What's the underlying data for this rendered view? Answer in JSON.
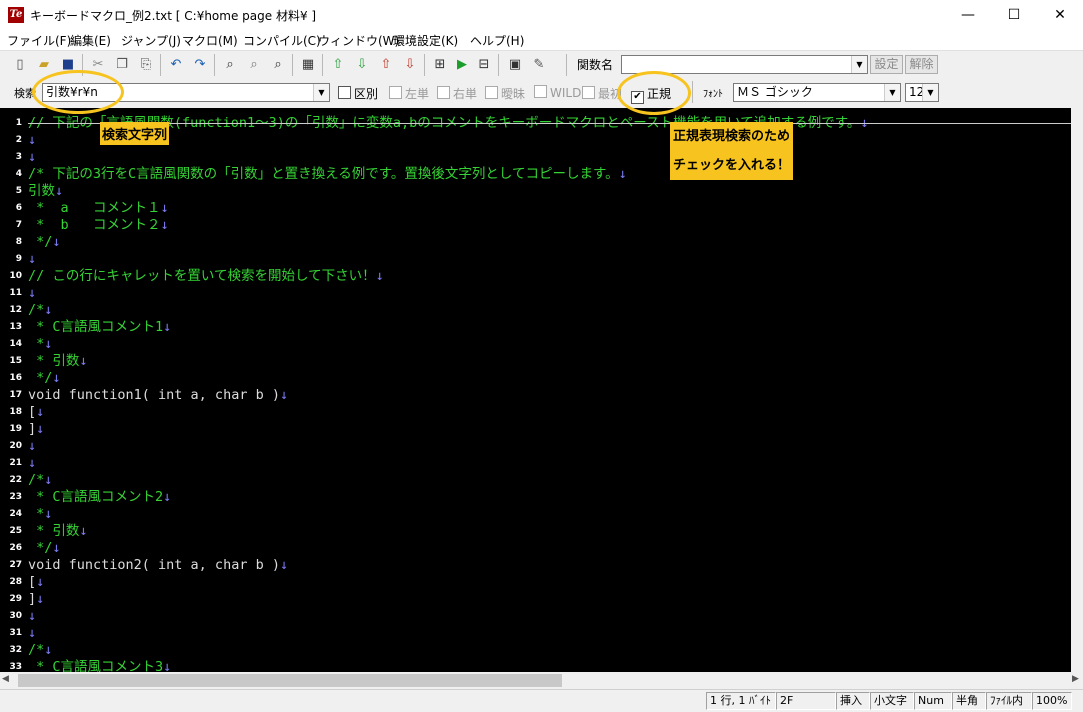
{
  "window": {
    "title": "キーボードマクロ_例2.txt [ C:¥home page 材料¥ ]",
    "app_icon": "Te",
    "controls": {
      "minimize": "—",
      "maximize": "☐",
      "close": "✕"
    }
  },
  "menu": [
    "ファイル(F)",
    "編集(E)",
    "ジャンプ(J)",
    "マクロ(M)",
    "コンパイル(C)",
    "ウィンドウ(W)",
    "環境設定(K)",
    "ヘルプ(H)"
  ],
  "toolbar": {
    "function_label": "関数名",
    "function_value": "",
    "set_button": "設定",
    "release_button": "解除",
    "icons": [
      "new-file-icon",
      "open-folder-icon",
      "save-icon",
      "cut-icon",
      "copy-icon",
      "paste-icon",
      "undo-icon",
      "redo-icon",
      "find-icon",
      "find-next-icon",
      "replace-icon",
      "grep-icon",
      "jump-up-icon",
      "jump-down-icon",
      "mark-up-icon",
      "mark-down-icon",
      "macro-record-icon",
      "macro-play-icon",
      "split-window-icon",
      "console-icon",
      "tool-icon"
    ]
  },
  "search": {
    "label": "検索",
    "value": "引数¥r¥n",
    "options": [
      {
        "label": "区別",
        "checked": false,
        "enabled": true
      },
      {
        "label": "左単",
        "checked": false,
        "enabled": false
      },
      {
        "label": "右単",
        "checked": false,
        "enabled": false
      },
      {
        "label": "曖昧",
        "checked": false,
        "enabled": false
      },
      {
        "label": "WILD",
        "checked": false,
        "enabled": false
      },
      {
        "label": "最初",
        "checked": false,
        "enabled": false
      },
      {
        "label": "正規",
        "checked": true,
        "enabled": true
      }
    ],
    "font_label": "ﾌｫﾝﾄ",
    "font_value": "ＭＳ ゴシック",
    "size_value": "12"
  },
  "editor": {
    "lines": [
      {
        "n": "1",
        "text": "// 下記の「言語風関数(function1～3)の「引数」に変数a,bのコメントをキーボードマクロとペースト機能を用いて追加する例です。",
        "type": "comment"
      },
      {
        "n": "2",
        "text": "",
        "type": "normal"
      },
      {
        "n": "3",
        "text": "",
        "type": "normal"
      },
      {
        "n": "4",
        "text": "/* 下記の3行をC言語風関数の「引数」と置き換える例です。置換後文字列としてコピーします。",
        "type": "comment"
      },
      {
        "n": "5",
        "text": "引数",
        "type": "comment"
      },
      {
        "n": "6",
        "text": " *  a   コメント１",
        "type": "comment"
      },
      {
        "n": "7",
        "text": " *  b   コメント２",
        "type": "comment"
      },
      {
        "n": "8",
        "text": " */",
        "type": "comment"
      },
      {
        "n": "9",
        "text": "",
        "type": "normal"
      },
      {
        "n": "10",
        "text": "// この行にキャレットを置いて検索を開始して下さい！",
        "type": "comment"
      },
      {
        "n": "11",
        "text": "",
        "type": "normal"
      },
      {
        "n": "12",
        "text": "/*",
        "type": "comment"
      },
      {
        "n": "13",
        "text": " * C言語風コメント1",
        "type": "comment"
      },
      {
        "n": "14",
        "text": " *",
        "type": "comment"
      },
      {
        "n": "15",
        "text": " * 引数",
        "type": "comment"
      },
      {
        "n": "16",
        "text": " */",
        "type": "comment"
      },
      {
        "n": "17",
        "text": "void function1( int a, char b )",
        "type": "normal"
      },
      {
        "n": "18",
        "text": "[",
        "type": "normal"
      },
      {
        "n": "19",
        "text": "]",
        "type": "normal"
      },
      {
        "n": "20",
        "text": "",
        "type": "normal"
      },
      {
        "n": "21",
        "text": "",
        "type": "normal"
      },
      {
        "n": "22",
        "text": "/*",
        "type": "comment"
      },
      {
        "n": "23",
        "text": " * C言語風コメント2",
        "type": "comment"
      },
      {
        "n": "24",
        "text": " *",
        "type": "comment"
      },
      {
        "n": "25",
        "text": " * 引数",
        "type": "comment"
      },
      {
        "n": "26",
        "text": " */",
        "type": "comment"
      },
      {
        "n": "27",
        "text": "void function2( int a, char b )",
        "type": "normal"
      },
      {
        "n": "28",
        "text": "[",
        "type": "normal"
      },
      {
        "n": "29",
        "text": "]",
        "type": "normal"
      },
      {
        "n": "30",
        "text": "",
        "type": "normal"
      },
      {
        "n": "31",
        "text": "",
        "type": "normal"
      },
      {
        "n": "32",
        "text": "/*",
        "type": "comment"
      },
      {
        "n": "33",
        "text": " * C言語風コメント3",
        "type": "comment"
      }
    ],
    "eol_mark": "↓"
  },
  "annotations": {
    "search_note": "検索文字列",
    "regex_note_1": "正規表現検索のため",
    "regex_note_2": "チェックを入れる！",
    "accent": "#f7c31e"
  },
  "status": {
    "position": "1 行, 1 ﾊﾞｲﾄ",
    "code": "2F",
    "mode": "挿入",
    "case": "小文字",
    "num": "Num",
    "width": "半角",
    "scope": "ﾌｧｲﾙ内",
    "zoom": "100%"
  }
}
